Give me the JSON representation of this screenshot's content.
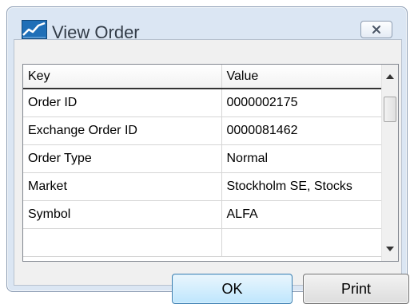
{
  "window": {
    "title": "View Order",
    "close_symbol": "×"
  },
  "table": {
    "columns": [
      "Key",
      "Value"
    ],
    "rows": [
      {
        "key": "Order ID",
        "value": "0000002175"
      },
      {
        "key": "Exchange Order ID",
        "value": "0000081462"
      },
      {
        "key": "Order Type",
        "value": "Normal"
      },
      {
        "key": "Market",
        "value": "Stockholm SE, Stocks"
      },
      {
        "key": "Symbol",
        "value": "ALFA"
      }
    ]
  },
  "buttons": {
    "ok_label": "OK",
    "print_label": "Print"
  },
  "colors": {
    "accent": "#3c7fb1",
    "window_bg": "#dbe6f3"
  },
  "icons": {
    "app_icon": "chart-line-icon",
    "close_icon": "close-icon",
    "scroll_up_icon": "triangle-up-icon",
    "scroll_down_icon": "triangle-down-icon"
  }
}
